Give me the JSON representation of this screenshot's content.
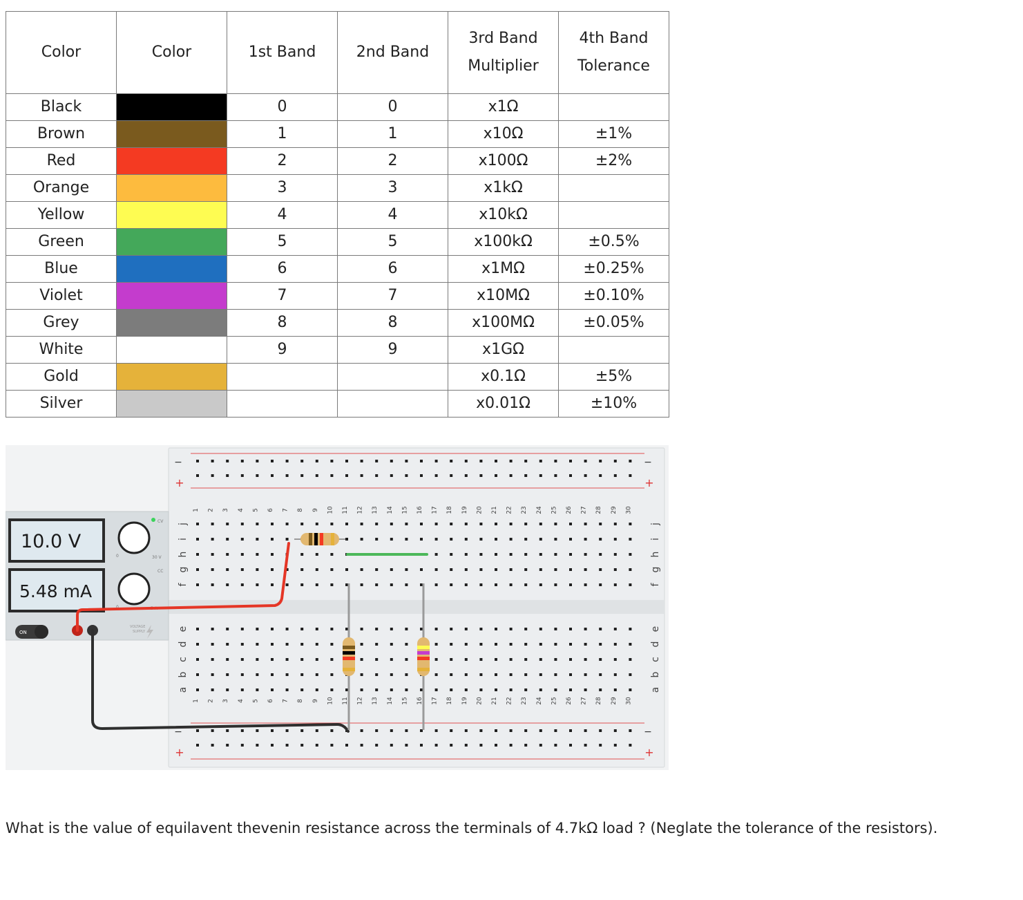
{
  "table": {
    "headers": [
      {
        "lines": [
          "Color"
        ]
      },
      {
        "lines": [
          "Color"
        ]
      },
      {
        "lines": [
          "1st Band"
        ]
      },
      {
        "lines": [
          "2nd Band"
        ]
      },
      {
        "lines": [
          "3rd Band",
          "Multiplier"
        ]
      },
      {
        "lines": [
          "4th Band",
          "Tolerance"
        ]
      }
    ],
    "rows": [
      {
        "name": "Black",
        "swatch": "#000000",
        "band1": "0",
        "band2": "0",
        "multiplier": "x1Ω",
        "tolerance": ""
      },
      {
        "name": "Brown",
        "swatch": "#7a5a1e",
        "band1": "1",
        "band2": "1",
        "multiplier": "x10Ω",
        "tolerance": "±1%"
      },
      {
        "name": "Red",
        "swatch": "#f43a22",
        "band1": "2",
        "band2": "2",
        "multiplier": "x100Ω",
        "tolerance": "±2%"
      },
      {
        "name": "Orange",
        "swatch": "#fdbb3e",
        "band1": "3",
        "band2": "3",
        "multiplier": "x1kΩ",
        "tolerance": ""
      },
      {
        "name": "Yellow",
        "swatch": "#fefc52",
        "band1": "4",
        "band2": "4",
        "multiplier": "x10kΩ",
        "tolerance": ""
      },
      {
        "name": "Green",
        "swatch": "#44a85a",
        "band1": "5",
        "band2": "5",
        "multiplier": "x100kΩ",
        "tolerance": "±0.5%"
      },
      {
        "name": "Blue",
        "swatch": "#1f6fbf",
        "band1": "6",
        "band2": "6",
        "multiplier": "x1MΩ",
        "tolerance": "±0.25%"
      },
      {
        "name": "Violet",
        "swatch": "#c43ccd",
        "band1": "7",
        "band2": "7",
        "multiplier": "x10MΩ",
        "tolerance": "±0.10%"
      },
      {
        "name": "Grey",
        "swatch": "#7c7c7c",
        "band1": "8",
        "band2": "8",
        "multiplier": "x100MΩ",
        "tolerance": "±0.05%"
      },
      {
        "name": "White",
        "swatch": "#ffffff",
        "band1": "9",
        "band2": "9",
        "multiplier": "x1GΩ",
        "tolerance": ""
      },
      {
        "name": "Gold",
        "swatch": "#e5b23a",
        "band1": "",
        "band2": "",
        "multiplier": "x0.1Ω",
        "tolerance": "±5%"
      },
      {
        "name": "Silver",
        "swatch": "#c9c9c9",
        "band1": "",
        "band2": "",
        "multiplier": "x0.01Ω",
        "tolerance": "±10%"
      }
    ]
  },
  "supply": {
    "voltage_reading": "10.0 V",
    "current_reading": "5.48 mA",
    "power_label": "ON",
    "panel_label_lines": [
      "VOLTAGE",
      "SUPPLY"
    ],
    "small_label_30v": "30 V",
    "small_label_5a": "5 A",
    "small_label_0v": "0",
    "small_label_0a": "0",
    "cv_label": "CV",
    "cc_label": "CC",
    "colors": {
      "panel": "#d8dde0",
      "display_bg": "#dfe9ef",
      "led_green": "#3cd35c"
    }
  },
  "breadboard": {
    "top_rows": [
      "j",
      "i",
      "h",
      "g",
      "f"
    ],
    "bottom_rows": [
      "e",
      "d",
      "c",
      "b",
      "a"
    ],
    "columns": [
      "1",
      "2",
      "3",
      "4",
      "5",
      "6",
      "7",
      "8",
      "9",
      "10",
      "11",
      "12",
      "13",
      "14",
      "15",
      "16",
      "17",
      "18",
      "19",
      "20",
      "21",
      "22",
      "23",
      "24",
      "25",
      "26",
      "27",
      "28",
      "29",
      "30"
    ],
    "rail_minus": "−",
    "rail_plus": "+"
  },
  "resistors": [
    {
      "id": "r-horizontal",
      "bands": [
        "#7a5a1e",
        "#000000",
        "#f43a22",
        "#e5b23a"
      ]
    },
    {
      "id": "r-vertical-left",
      "bands": [
        "#7a5a1e",
        "#000000",
        "#f43a22",
        "#e5b23a"
      ]
    },
    {
      "id": "r-vertical-right",
      "bands": [
        "#fefc52",
        "#c43ccd",
        "#f43a22",
        "#e5b23a"
      ]
    }
  ],
  "wires": {
    "red": "#e53626",
    "black": "#2f2f2f",
    "green": "#4cb85a"
  },
  "question": "What is the value of equilavent thevenin resistance across the terminals of  4.7kΩ  load ? (Neglate the tolerance of the resistors)."
}
